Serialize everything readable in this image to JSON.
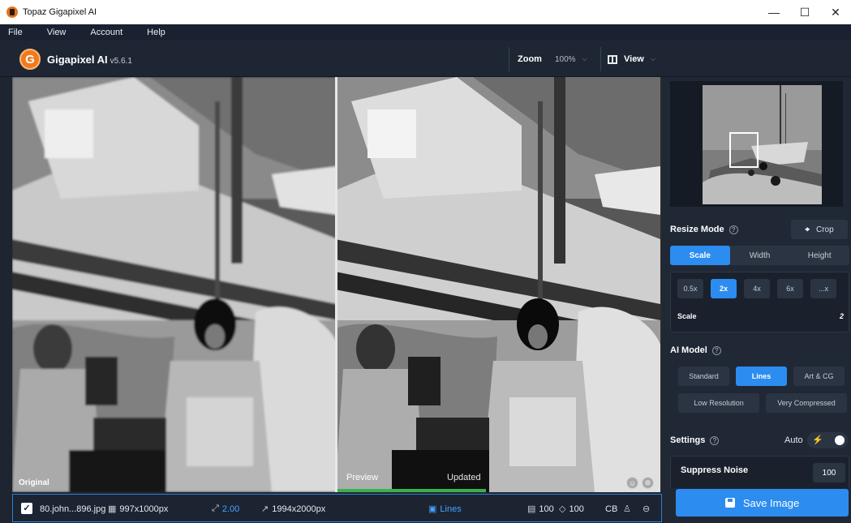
{
  "window": {
    "title": "Topaz Gigapixel AI",
    "minimize": "—",
    "maximize": "☐",
    "close": "✕"
  },
  "menu": [
    "File",
    "View",
    "Account",
    "Help"
  ],
  "header": {
    "logo_letter": "G",
    "app_name": "Gigapixel AI",
    "version": "v5.6.1",
    "zoom_label": "Zoom",
    "zoom_value": "100%",
    "view_label": "View"
  },
  "viewer": {
    "original_label": "Original",
    "preview_label": "Preview",
    "updated_label": "Updated",
    "preview_progress": 0.46
  },
  "status": {
    "filename": "80.john...896.jpg",
    "source_size": "997x1000px",
    "scale": "2.00",
    "output_size": "1994x2000px",
    "model": "Lines",
    "noise_value": "100",
    "blur_value": "100",
    "cb_label": "CB"
  },
  "panel": {
    "resize_mode_label": "Resize Mode",
    "crop_label": "Crop",
    "modes": [
      "Scale",
      "Width",
      "Height"
    ],
    "active_mode": "Scale",
    "scale_options": [
      "0.5x",
      "2x",
      "4x",
      "6x",
      "...x"
    ],
    "active_scale": "2x",
    "scale_label": "Scale",
    "scale_value": "2",
    "ai_model_label": "AI Model",
    "models_row1": [
      "Standard",
      "Lines",
      "Art & CG"
    ],
    "models_row2": [
      "Low Resolution",
      "Very Compressed"
    ],
    "active_model": "Lines",
    "settings_label": "Settings",
    "auto_label": "Auto",
    "suppress_noise_label": "Suppress Noise",
    "suppress_noise_value": "100",
    "save_label": "Save Image"
  },
  "colors": {
    "accent": "#2c8cf0",
    "progress": "#3db04a",
    "logo": "#f07a1f"
  }
}
